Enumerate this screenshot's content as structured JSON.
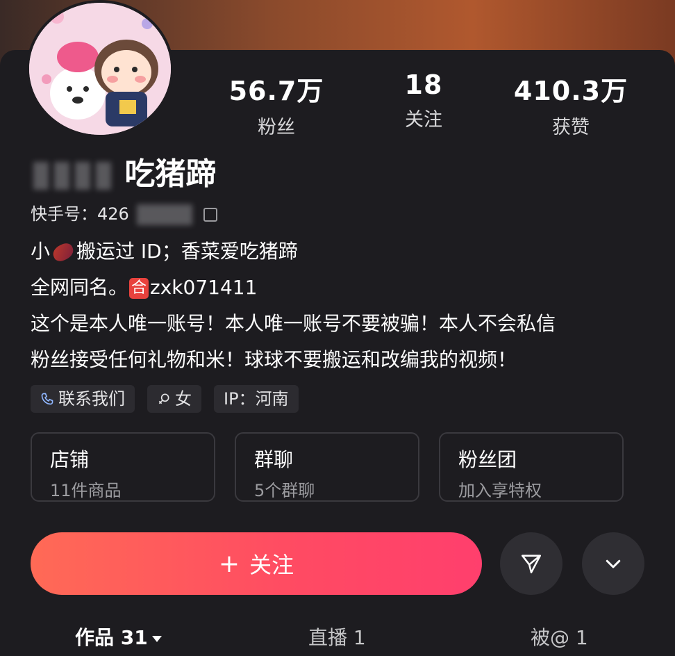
{
  "profile": {
    "name_visible": "吃猪蹄",
    "uid_label": "快手号：426",
    "bio_lines": [
      "小",
      "搬运过 ID；香菜爱吃猪蹄",
      "全网同名。",
      "zxk071411",
      "这个是本人唯一账号！本人唯一账号不要被骗！本人不会私信",
      "粉丝接受任何礼物和米！球球不要搬运和改编我的视频！"
    ],
    "he_badge": "合"
  },
  "stats": [
    {
      "value": "56.7万",
      "label": "粉丝"
    },
    {
      "value": "18",
      "label": "关注"
    },
    {
      "value": "410.3万",
      "label": "获赞"
    }
  ],
  "tags": [
    {
      "label": "联系我们",
      "icon": "phone-icon"
    },
    {
      "label": "女",
      "icon": "female-icon"
    },
    {
      "label": "IP：河南",
      "icon": ""
    }
  ],
  "cards": [
    {
      "title": "店铺",
      "sub": "11件商品"
    },
    {
      "title": "群聊",
      "sub": "5个群聊"
    },
    {
      "title": "粉丝团",
      "sub": "加入享特权"
    }
  ],
  "actions": {
    "follow_plus": "+",
    "follow_label": "关注",
    "share_icon": "send-icon",
    "more_icon": "chevron-down-icon"
  },
  "tabs": [
    {
      "label": "作品 31",
      "active": true
    },
    {
      "label": "直播 1",
      "active": false
    },
    {
      "label": "被@ 1",
      "active": false
    }
  ],
  "colors": {
    "background": "#1d1c20",
    "follow_gradient_start": "#ff6a56",
    "follow_gradient_end": "#ff3f6d"
  }
}
